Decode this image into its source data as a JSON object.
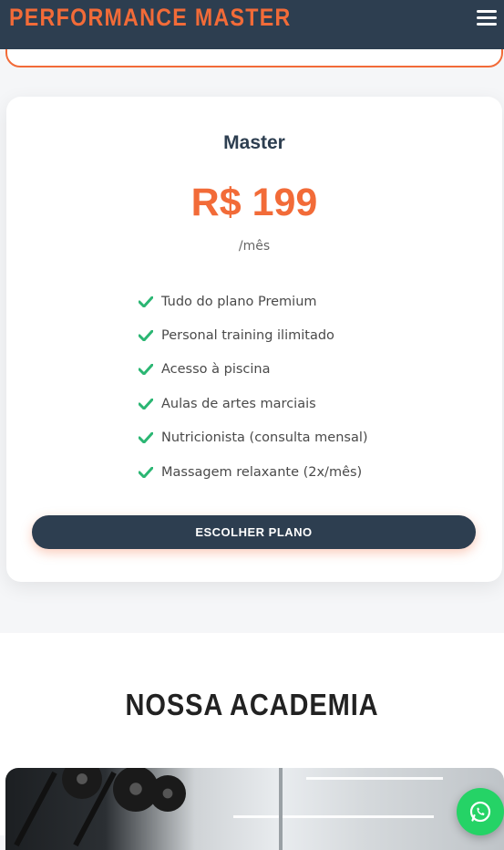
{
  "header": {
    "brand": "PERFORMANCE MASTER",
    "menu_icon": "bars-icon"
  },
  "plan": {
    "name": "Master",
    "price": "R$ 199",
    "period": "/mês",
    "features": [
      "Tudo do plano Premium",
      "Personal training ilimitado",
      "Acesso à piscina",
      "Aulas de artes marciais",
      "Nutricionista (consulta mensal)",
      "Massagem relaxante (2x/mês)"
    ],
    "cta_label": "ESCOLHER PLANO"
  },
  "gallery": {
    "title": "NOSSA ACADEMIA"
  },
  "colors": {
    "primary": "#2d3e50",
    "accent": "#f26b38",
    "check": "#2bb673",
    "whatsapp": "#25d366"
  },
  "floating": {
    "icon": "whatsapp-icon"
  }
}
